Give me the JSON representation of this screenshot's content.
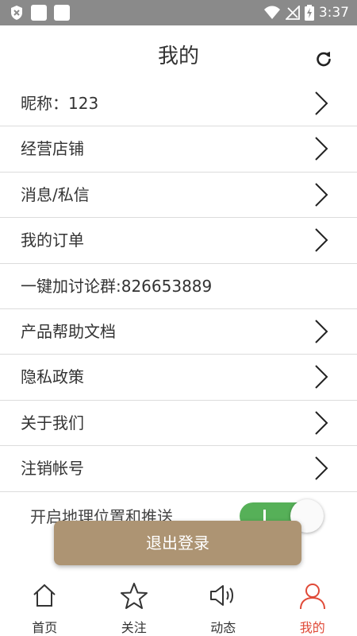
{
  "status_bar": {
    "time": "3:37"
  },
  "header": {
    "title": "我的",
    "refresh_icon": "refresh-icon"
  },
  "menu": {
    "items": [
      {
        "label": "昵称：123",
        "has_chevron": true
      },
      {
        "label": "经营店铺",
        "has_chevron": true
      },
      {
        "label": "消息/私信",
        "has_chevron": true
      },
      {
        "label": "我的订单",
        "has_chevron": true
      },
      {
        "label": "一键加讨论群:826653889",
        "has_chevron": false
      },
      {
        "label": "产品帮助文档",
        "has_chevron": true
      },
      {
        "label": "隐私政策",
        "has_chevron": true
      },
      {
        "label": "关于我们",
        "has_chevron": true
      },
      {
        "label": "注销帐号",
        "has_chevron": true
      }
    ]
  },
  "location": {
    "label": "开启地理位置和推送",
    "enabled": true
  },
  "logout": {
    "label": "退出登录"
  },
  "bottom_nav": {
    "items": [
      {
        "label": "首页",
        "icon": "home-icon",
        "active": false
      },
      {
        "label": "关注",
        "icon": "star-icon",
        "active": false
      },
      {
        "label": "动态",
        "icon": "speaker-icon",
        "active": false
      },
      {
        "label": "我的",
        "icon": "user-icon",
        "active": true
      }
    ]
  },
  "colors": {
    "accent": "#e04a38",
    "logout_bg": "#ad9473",
    "toggle_on": "#56b058",
    "status_bar": "#8a8a8a"
  }
}
